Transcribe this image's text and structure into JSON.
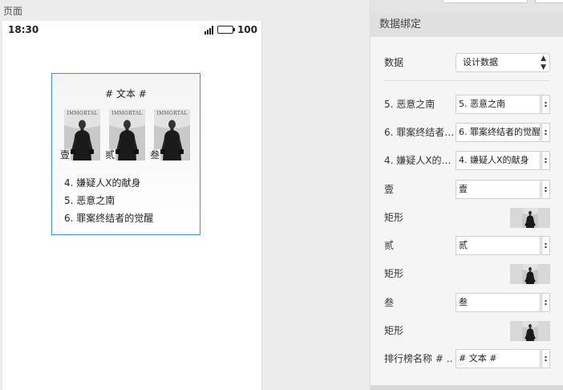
{
  "page_label": "页面",
  "status_bar": {
    "time": "18:30",
    "battery": "100"
  },
  "widget": {
    "title": "# 文本 #",
    "covers": [
      {
        "badge": "壹",
        "cover_text": "IMMORTAL"
      },
      {
        "badge": "贰",
        "cover_text": "IMMORTAL"
      },
      {
        "badge": "叁",
        "cover_text": "IMMORTAL"
      }
    ],
    "rank_list": [
      "4. 嫌疑人X的献身",
      "5. 恶意之南",
      "6. 罪案终结者的觉醒"
    ]
  },
  "panel": {
    "header": "数据绑定",
    "data_row": {
      "label": "数据",
      "value": "设计数据"
    },
    "rows": [
      {
        "label": "5. 恶意之南",
        "value": "5. 恶意之南",
        "kind": "input"
      },
      {
        "label": "6. 罪案终结者…",
        "value": "6. 罪案终结者的觉醒",
        "kind": "input"
      },
      {
        "label": "4. 嫌疑人X的…",
        "value": "4. 嫌疑人X的献身",
        "kind": "input"
      },
      {
        "label": "壹",
        "value": "壹",
        "kind": "input"
      },
      {
        "label": "矩形",
        "kind": "image"
      },
      {
        "label": "贰",
        "value": "贰",
        "kind": "input"
      },
      {
        "label": "矩形",
        "kind": "image"
      },
      {
        "label": "叁",
        "value": "叁",
        "kind": "input"
      },
      {
        "label": "矩形",
        "kind": "image"
      },
      {
        "label": "排行榜名称 # …",
        "value": "# 文本 #",
        "kind": "input"
      }
    ],
    "menu_glyph": ":"
  }
}
